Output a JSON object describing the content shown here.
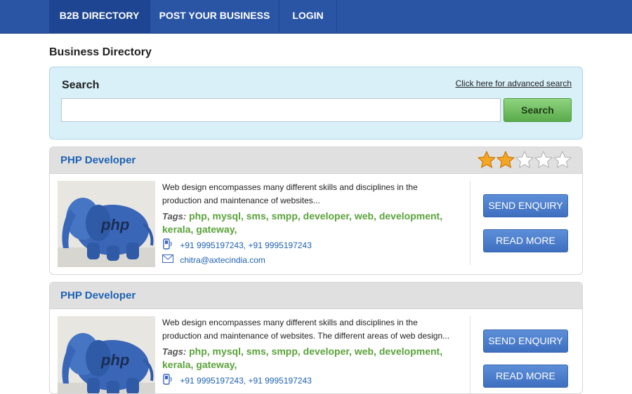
{
  "nav": {
    "items": [
      {
        "label": "B2B DIRECTORY",
        "active": true
      },
      {
        "label": "POST YOUR BUSINESS",
        "active": false
      },
      {
        "label": "LOGIN",
        "active": false
      }
    ]
  },
  "page": {
    "title": "Business Directory"
  },
  "search": {
    "heading": "Search",
    "advanced_link": "Click here for advanced search",
    "value": "",
    "placeholder": "",
    "button": "Search"
  },
  "listings": [
    {
      "title": "PHP Developer",
      "rating": 2,
      "rating_max": 5,
      "thumbnail_text": "php",
      "description_line1": "Web design encompasses many different skills and disciplines in the",
      "description_line2": "production and maintenance of websites...",
      "tags_label": "Tags:",
      "tags": "php, mysql, sms, smpp, developer, web, development, kerala, gateway,",
      "phone": "+91 9995197243, +91 9995197243",
      "email": "chitra@axtecindia.com",
      "enquiry_button": "SEND ENQUIRY",
      "readmore_button": "READ MORE"
    },
    {
      "title": "PHP Developer",
      "thumbnail_text": "php",
      "description_line1": "Web design encompasses many different skills and disciplines in the",
      "description_line2": "production and maintenance of websites. The different areas of web design...",
      "tags_label": "Tags:",
      "tags": "php, mysql, sms, smpp, developer, web, development, kerala, gateway,",
      "phone": "+91 9995197243, +91 9995197243",
      "enquiry_button": "SEND ENQUIRY",
      "readmore_button": "READ MORE"
    }
  ],
  "colors": {
    "nav_bg": "#2a55a5",
    "link_blue": "#1e62b5",
    "tag_green": "#5aa23a",
    "search_bg": "#d9f0f9",
    "star_filled": "#f5a623",
    "star_empty": "#ffffff"
  },
  "icons": {
    "phone": "mobile-phone-icon",
    "email": "envelope-icon",
    "star": "star-icon"
  }
}
